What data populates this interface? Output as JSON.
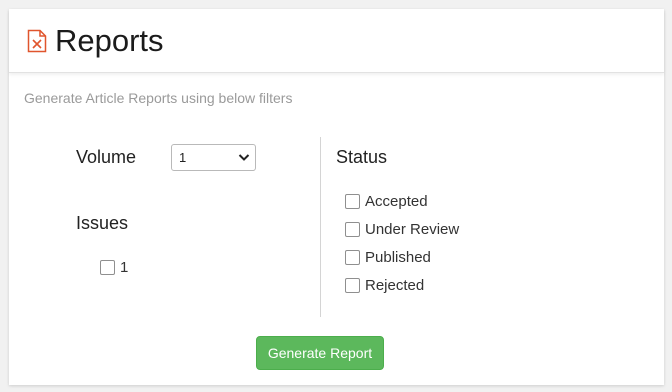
{
  "header": {
    "title": "Reports",
    "icon": "excel-file-icon",
    "icon_color": "#e0552d"
  },
  "subtitle": "Generate Article Reports using below filters",
  "filters": {
    "volume_label": "Volume",
    "volume_selected": "1",
    "issues_label": "Issues",
    "issues": [
      {
        "label": "1",
        "checked": false
      }
    ],
    "status_label": "Status",
    "statuses": [
      {
        "label": "Accepted",
        "checked": false
      },
      {
        "label": "Under Review",
        "checked": false
      },
      {
        "label": "Published",
        "checked": false
      },
      {
        "label": "Rejected",
        "checked": false
      }
    ]
  },
  "actions": {
    "generate_label": "Generate Report",
    "generate_color": "#5cb85c"
  }
}
